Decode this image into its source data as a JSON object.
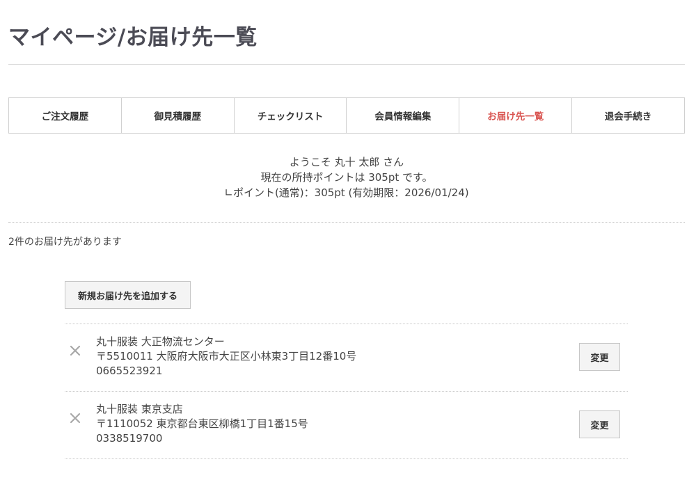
{
  "page": {
    "title": "マイページ/お届け先一覧"
  },
  "tabs": [
    {
      "label": "ご注文履歴",
      "active": false
    },
    {
      "label": "御見積履歴",
      "active": false
    },
    {
      "label": "チェックリスト",
      "active": false
    },
    {
      "label": "会員情報編集",
      "active": false
    },
    {
      "label": "お届け先一覧",
      "active": true
    },
    {
      "label": "退会手続き",
      "active": false
    }
  ],
  "welcome": {
    "greeting": "ようこそ 丸十 太郎 さん",
    "points": "現在の所持ポイントは 305pt です。",
    "points_detail": "∟ポイント(通常)：305pt (有効期限：2026/01/24)"
  },
  "addresses": {
    "count_text": "2件のお届け先があります",
    "add_button_label": "新規お届け先を追加する",
    "items": [
      {
        "name": "丸十服装 大正物流センター",
        "address": "〒5510011 大阪府大阪市大正区小林東3丁目12番10号",
        "phone": "0665523921",
        "edit_label": "変更"
      },
      {
        "name": "丸十服装 東京支店",
        "address": "〒1110052 東京都台東区柳橋1丁目1番15号",
        "phone": "0338519700",
        "edit_label": "変更"
      }
    ]
  },
  "colors": {
    "active_tab": "#d9534f",
    "title": "#4b4b55",
    "border": "#d0d0d0",
    "button_bg": "#f4f4f4",
    "remove_icon": "#a8a8a8"
  }
}
